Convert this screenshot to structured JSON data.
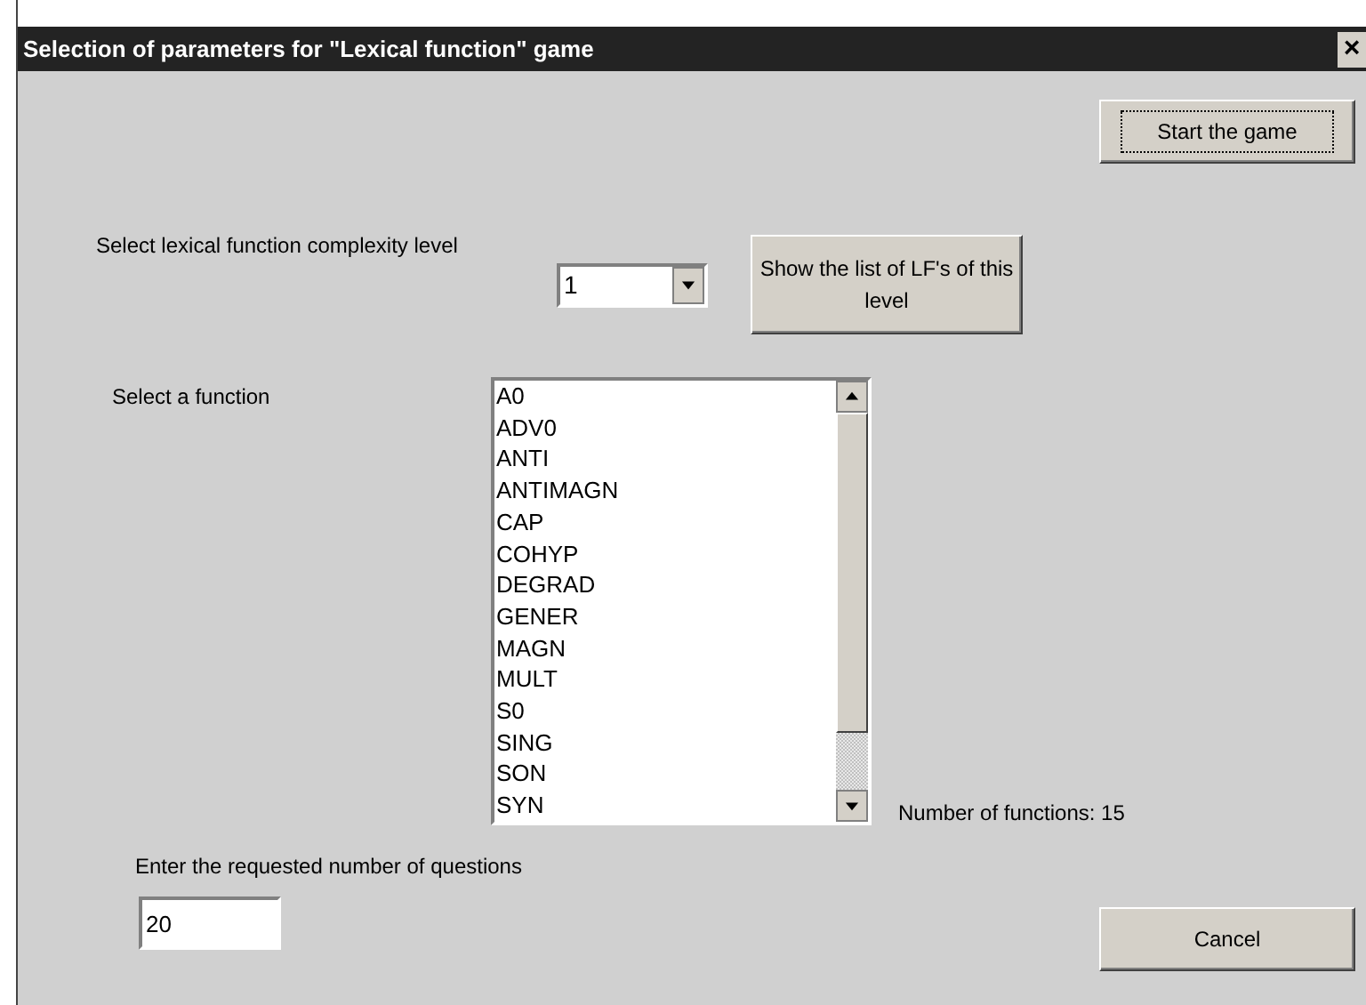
{
  "window": {
    "title": "Selection of parameters for \"Lexical function\" game",
    "close": "×"
  },
  "start_button": "Start the game",
  "complexity": {
    "label": "Select lexical function complexity level",
    "value": "1"
  },
  "show_list_button": "Show the list of LF's of this level",
  "function_list": {
    "label": "Select a function",
    "items": [
      "A0",
      "ADV0",
      "ANTI",
      "ANTIMAGN",
      "CAP",
      "COHYP",
      "DEGRAD",
      "GENER",
      "MAGN",
      "MULT",
      "S0",
      "SING",
      "SON",
      "SYN"
    ]
  },
  "function_count": "Number of functions: 15",
  "questions": {
    "label": "Enter the requested number of questions",
    "value": "20"
  },
  "cancel_button": "Cancel"
}
